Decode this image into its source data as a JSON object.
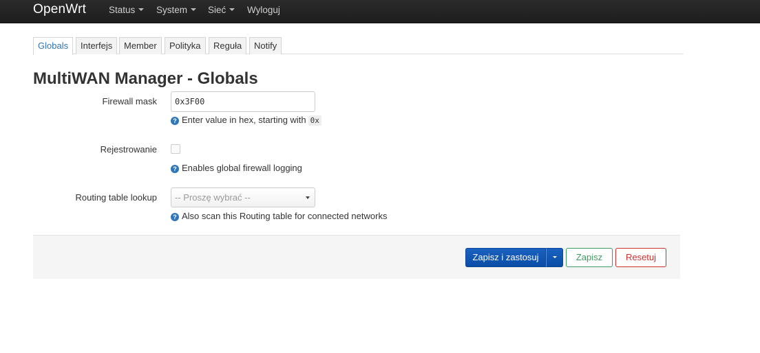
{
  "navbar": {
    "brand": "OpenWrt",
    "items": [
      {
        "label": "Status",
        "has_dropdown": true
      },
      {
        "label": "System",
        "has_dropdown": true
      },
      {
        "label": "Sieć",
        "has_dropdown": true
      },
      {
        "label": "Wyloguj",
        "has_dropdown": false
      }
    ]
  },
  "tabs": [
    {
      "label": "Globals",
      "active": true
    },
    {
      "label": "Interfejs",
      "active": false
    },
    {
      "label": "Member",
      "active": false
    },
    {
      "label": "Polityka",
      "active": false
    },
    {
      "label": "Reguła",
      "active": false
    },
    {
      "label": "Notify",
      "active": false
    }
  ],
  "page": {
    "title": "MultiWAN Manager - Globals"
  },
  "form": {
    "firewall_mask": {
      "label": "Firewall mask",
      "value": "0x3F00",
      "help_text": "Enter value in hex, starting with",
      "help_code": "0x"
    },
    "logging": {
      "label": "Rejestrowanie",
      "checked": false,
      "help_text": "Enables global firewall logging"
    },
    "routing_table": {
      "label": "Routing table lookup",
      "selected": "-- Proszę wybrać --",
      "help_text": "Also scan this Routing table for connected networks"
    }
  },
  "actions": {
    "save_apply_label": "Zapisz i zastosuj",
    "save_label": "Zapisz",
    "reset_label": "Resetuj"
  },
  "colors": {
    "navbar_bg": "#222222",
    "active_tab_text": "#2f77b8",
    "primary_button": "#0a4da6",
    "save_button": "#3a9d5d",
    "reset_button": "#c9302c",
    "help_icon": "#2f77b8"
  },
  "icons": {
    "help": "question-circle-icon",
    "dropdown": "caret-down-icon"
  }
}
